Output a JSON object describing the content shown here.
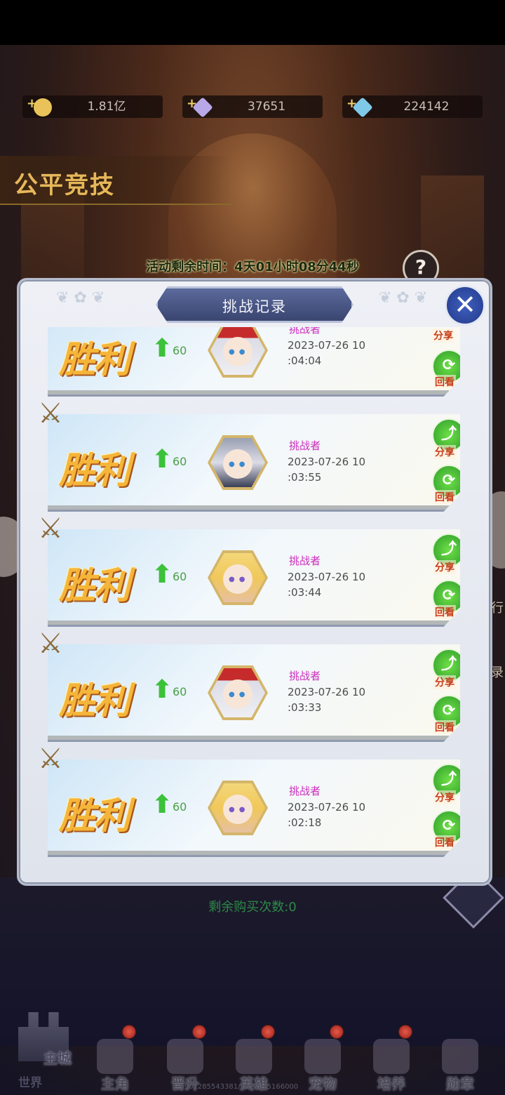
{
  "currency": {
    "gold": "1.81亿",
    "crystal": "37651",
    "diamond": "224142",
    "gold_icon_color": "#e9c35a",
    "crystal_icon_color": "#b9a8e8",
    "diamond_icon_color": "#7fc8e8"
  },
  "page_title": "公平竞技",
  "event_timer": "活动剩余时间：4天01小时08分44秒",
  "help_label": "?",
  "buy_remaining": "剩余购买次数:0",
  "panel": {
    "title": "挑战记录",
    "close_label": "✕",
    "records": [
      {
        "result": "胜利",
        "points": "60",
        "role": "挑战者",
        "date": "2023-07-26 10",
        "time": ":04:04",
        "share": "分享",
        "replay": "回看",
        "avatar": "silver-hair-red-hat"
      },
      {
        "result": "胜利",
        "points": "60",
        "role": "挑战者",
        "date": "2023-07-26 10",
        "time": ":03:55",
        "share": "分享",
        "replay": "回看",
        "avatar": "silver-hair-armor"
      },
      {
        "result": "胜利",
        "points": "60",
        "role": "挑战者",
        "date": "2023-07-26 10",
        "time": ":03:44",
        "share": "分享",
        "replay": "回看",
        "avatar": "blonde-hair"
      },
      {
        "result": "胜利",
        "points": "60",
        "role": "挑战者",
        "date": "2023-07-26 10",
        "time": ":03:33",
        "share": "分享",
        "replay": "回看",
        "avatar": "silver-hair-red-hat"
      },
      {
        "result": "胜利",
        "points": "60",
        "role": "挑战者",
        "date": "2023-07-26 10",
        "time": ":02:18",
        "share": "分享",
        "replay": "回看",
        "avatar": "blonde-hair"
      }
    ]
  },
  "right_edge": {
    "top": "行",
    "bottom": "录"
  },
  "bottom_nav": {
    "main_city": "主城",
    "world": "世界",
    "items": [
      {
        "label": "主角",
        "icon": "protagonist-icon"
      },
      {
        "label": "晋升",
        "icon": "promotion-icon"
      },
      {
        "label": "英雄",
        "icon": "hero-icon"
      },
      {
        "label": "宠物",
        "icon": "pet-icon"
      },
      {
        "label": "培养",
        "icon": "cultivate-icon"
      },
      {
        "label": "勋章",
        "icon": "medal-icon"
      }
    ]
  },
  "footer_id": "15901285543381/2222345166000"
}
